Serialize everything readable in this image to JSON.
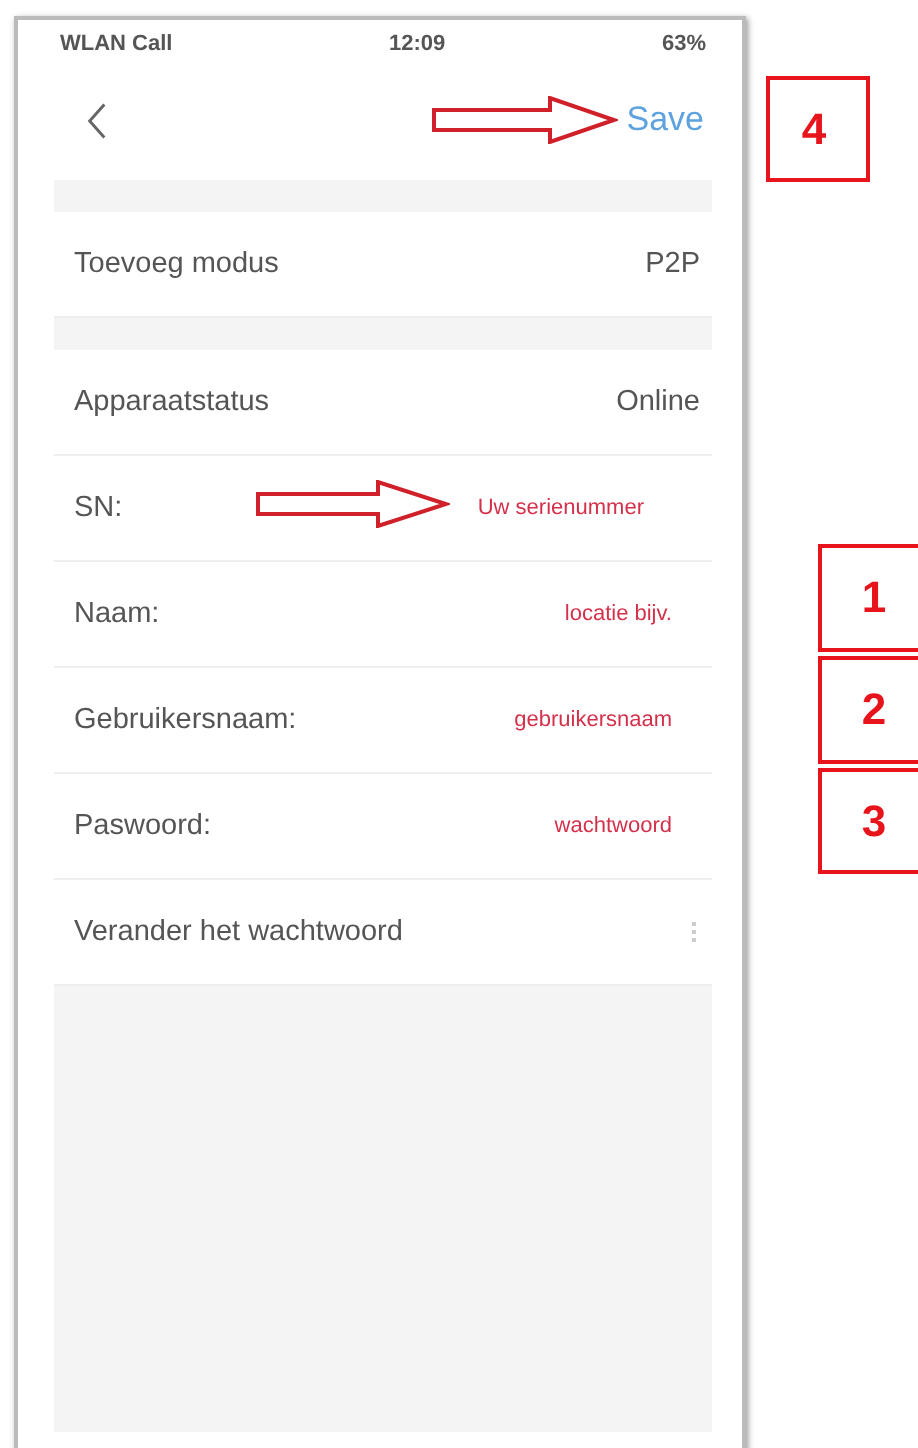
{
  "status_bar": {
    "carrier": "WLAN Call",
    "time": "12:09",
    "battery": "63%"
  },
  "nav": {
    "action": "Save"
  },
  "groups": [
    {
      "rows": [
        {
          "label": "Toevoeg modus",
          "value": "P2P",
          "kind": "value"
        }
      ]
    },
    {
      "rows": [
        {
          "label": "Apparaatstatus",
          "value": "Online",
          "kind": "value"
        },
        {
          "label": "SN:",
          "value": "Uw serienummer",
          "kind": "note",
          "arrow": true
        },
        {
          "label": "Naam:",
          "value": "locatie bijv.",
          "kind": "note"
        },
        {
          "label": "Gebruikersnaam:",
          "value": "gebruikersnaam",
          "kind": "note"
        },
        {
          "label": "Paswoord:",
          "value": "wachtwoord",
          "kind": "note"
        },
        {
          "label": "Verander het wachtwoord",
          "kind": "link"
        }
      ]
    }
  ],
  "callouts": [
    {
      "number": "4"
    },
    {
      "number": "1"
    },
    {
      "number": "2"
    },
    {
      "number": "3"
    }
  ]
}
